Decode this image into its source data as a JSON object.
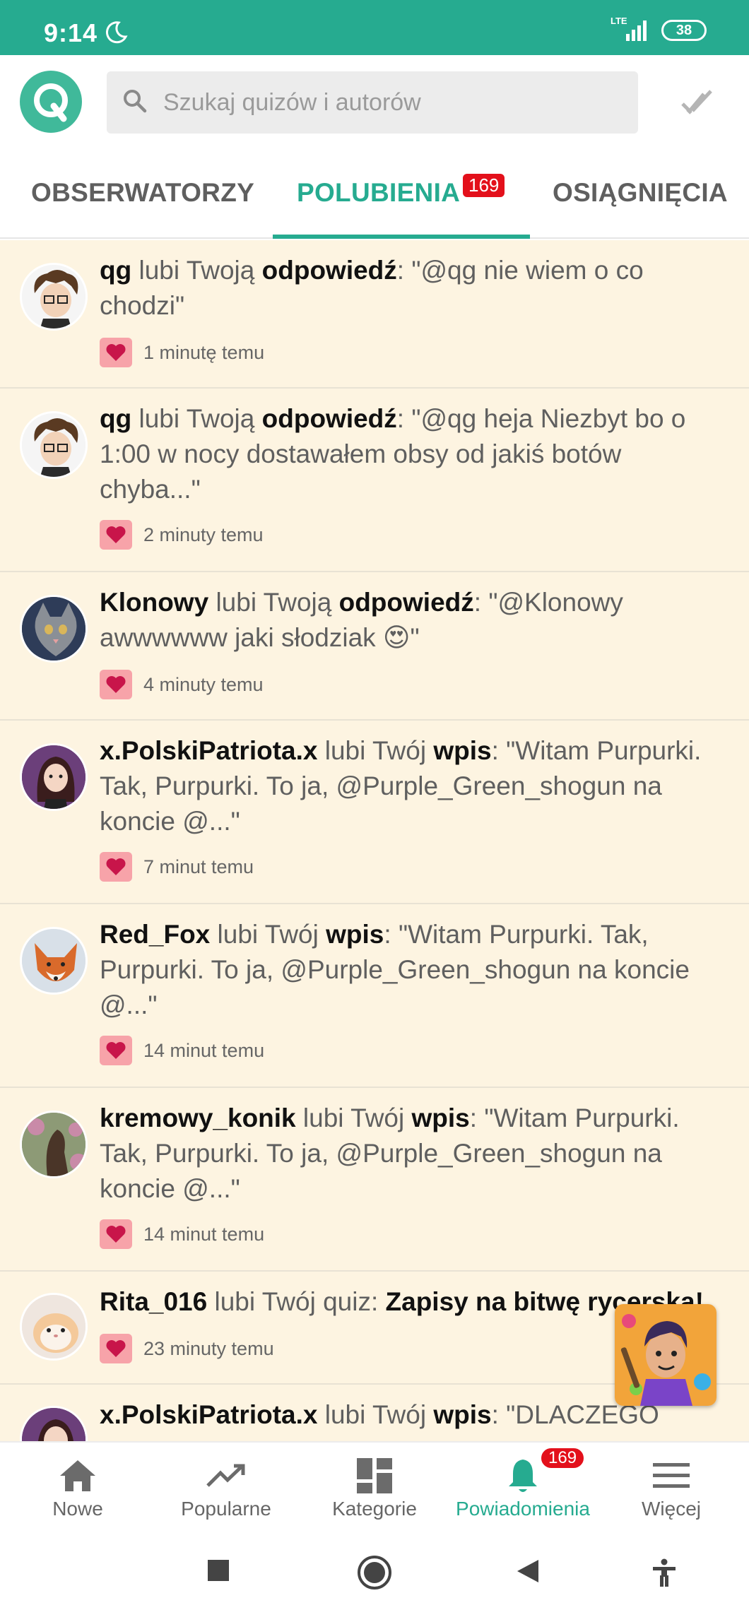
{
  "status_bar": {
    "time": "9:14",
    "network": "LTE",
    "battery": "38"
  },
  "colors": {
    "accent": "#26ab90",
    "badge": "#e3101b",
    "item_bg": "#fdf4e1",
    "heart": "#c8154a"
  },
  "header": {
    "search_placeholder": "Szukaj quizów i autorów",
    "logo_icon": "q-logo-icon",
    "check_icon": "double-check-icon"
  },
  "tabs": {
    "followers": "OBSERWATORZY",
    "likes": "POLUBIENIA",
    "likes_badge": "169",
    "achievements": "OSIĄGNIĘCIA"
  },
  "notifications": [
    {
      "user": "qg",
      "verb": "lubi Twoją",
      "object": "odpowiedź",
      "text": "\"@qg nie wiem o co chodzi\"",
      "time": "1 minutę temu"
    },
    {
      "user": "qg",
      "verb": "lubi Twoją",
      "object": "odpowiedź",
      "text": "\"@qg heja Niezbyt bo o 1:00 w nocy dostawałem obsy od jakiś botów chyba...\"",
      "time": "2 minuty temu"
    },
    {
      "user": "Klonowy",
      "verb": "lubi Twoją",
      "object": "odpowiedź",
      "text": "\"@Klonowy awwwwww jaki słodziak 😍\"",
      "time": "4 minuty temu"
    },
    {
      "user": "x.PolskiPatriota.x",
      "verb": "lubi Twój",
      "object": "wpis",
      "text": "\"Witam Purpurki. Tak, Purpurki. To ja, @Purple_Green_shogun na koncie @...\"",
      "time": "7 minut temu"
    },
    {
      "user": "Red_Fox",
      "verb": "lubi Twój",
      "object": "wpis",
      "text": "\"Witam Purpurki. Tak, Purpurki. To ja, @Purple_Green_shogun na koncie @...\"",
      "time": "14 minut temu"
    },
    {
      "user": "kremowy_konik",
      "verb": "lubi Twój",
      "object": "wpis",
      "text": "\"Witam Purpurki. Tak, Purpurki. To ja, @Purple_Green_shogun na koncie @...\"",
      "time": "14 minut temu"
    },
    {
      "user": "Rita_016",
      "verb": "lubi Twój quiz:",
      "object": "Zapisy na bitwę rycerską!",
      "text": "",
      "time": "23 minuty temu"
    },
    {
      "user": "x.PolskiPatriota.x",
      "verb": "lubi Twój",
      "object": "wpis",
      "text": "\"DLACZEGO",
      "time": ""
    }
  ],
  "bottom_nav": [
    {
      "label": "Nowe",
      "icon": "home-icon"
    },
    {
      "label": "Popularne",
      "icon": "trending-icon"
    },
    {
      "label": "Kategorie",
      "icon": "dashboard-icon"
    },
    {
      "label": "Powiadomienia",
      "icon": "bell-icon",
      "badge": "169"
    },
    {
      "label": "Więcej",
      "icon": "menu-icon"
    }
  ],
  "system_nav": [
    "square-icon",
    "circle-home-icon",
    "back-triangle-icon",
    "accessibility-icon"
  ]
}
